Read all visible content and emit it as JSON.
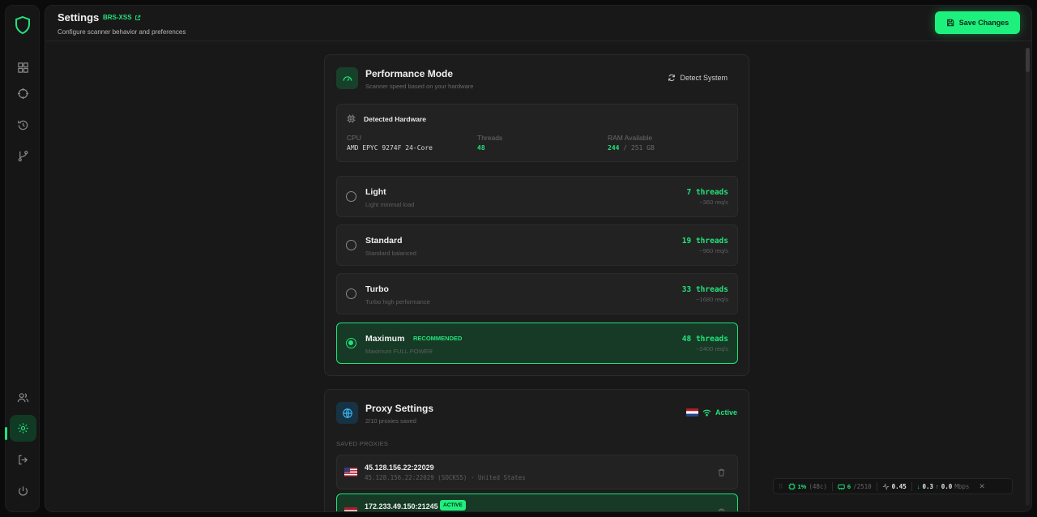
{
  "header": {
    "title": "Settings",
    "tag": "BRS-XSS",
    "subtitle": "Configure scanner behavior and preferences",
    "save_label": "Save Changes"
  },
  "performance": {
    "title": "Performance Mode",
    "subtitle": "Scanner speed based on your hardware",
    "detect_label": "Detect System",
    "hardware": {
      "title": "Detected Hardware",
      "cpu_label": "CPU",
      "cpu_value": "AMD EPYC 9274F 24-Core",
      "threads_label": "Threads",
      "threads_value": "48",
      "ram_label": "RAM Available",
      "ram_available": "244",
      "ram_total": "/ 251 GB"
    },
    "modes": [
      {
        "name": "Light",
        "desc": "Light minimal load",
        "threads": "7 threads",
        "req": "~360 req/s",
        "selected": false
      },
      {
        "name": "Standard",
        "desc": "Standard balanced",
        "threads": "19 threads",
        "req": "~960 req/s",
        "selected": false
      },
      {
        "name": "Turbo",
        "desc": "Turbo high performance",
        "threads": "33 threads",
        "req": "~1680 req/s",
        "selected": false
      },
      {
        "name": "Maximum",
        "desc": "Maximum FULL POWER",
        "threads": "48 threads",
        "req": "~2400 req/s",
        "selected": true,
        "badge": "RECOMMENDED"
      }
    ]
  },
  "proxy": {
    "title": "Proxy Settings",
    "subtitle": "2/10 proxies saved",
    "status": "Active",
    "saved_label": "SAVED PROXIES",
    "items": [
      {
        "ip": "45.128.156.22:22029",
        "info": "45.128.156.22:22029 (SOCKS5) · United States",
        "flag": "us-flag"
      },
      {
        "ip": "172.233.49.150:21245",
        "badge": "ACTIVE",
        "flag": "nl-flag"
      }
    ]
  },
  "statusbar": {
    "cpu": "1%",
    "cpu_cores": "(48c)",
    "mem": "6",
    "mem_total": "/2510",
    "load": "0.45",
    "down": "0.3",
    "up": "0.0",
    "unit": "Mbps"
  },
  "colors": {
    "accent": "#1ef07e",
    "bg": "#0b0b0b",
    "panel": "#181818",
    "card": "#1c1c1c"
  }
}
